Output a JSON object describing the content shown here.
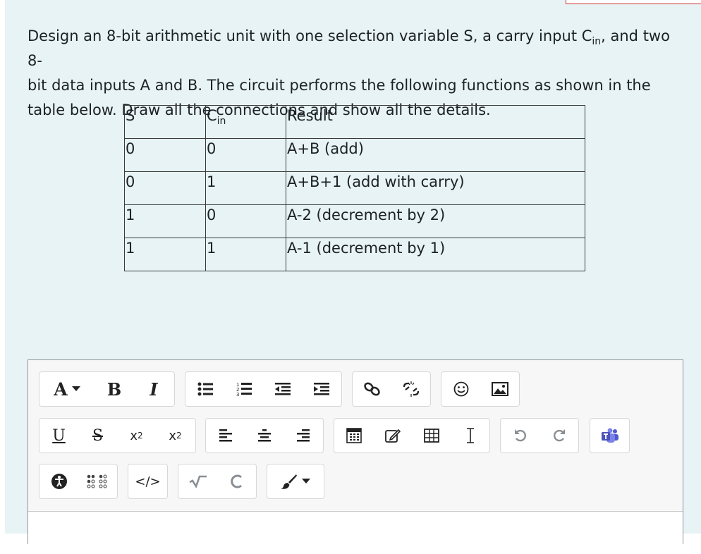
{
  "question": {
    "line1_before": "Design an 8-bit arithmetic unit with one selection variable S, a carry input C",
    "cin_sub": "in",
    "line1_after": ", and two 8-",
    "line2": "bit data inputs A and B. The circuit performs the following functions as shown in the",
    "line3": "table below. Draw all the connections and show all the details."
  },
  "table": {
    "header": {
      "s": "S",
      "c": "C",
      "c_sub": "in",
      "result": "Result"
    },
    "rows": [
      {
        "s": "0",
        "cin": "0",
        "result": "A+B (add)"
      },
      {
        "s": "0",
        "cin": "1",
        "result": "A+B+1 (add with carry)"
      },
      {
        "s": "1",
        "cin": "0",
        "result": "A-2 (decrement by 2)"
      },
      {
        "s": "1",
        "cin": "1",
        "result": "A-1 (decrement by 1)"
      }
    ]
  },
  "toolbar": {
    "font_color_label": "A",
    "bold_label": "B",
    "italic_label": "I",
    "underline_label": "U",
    "strike_label": "S",
    "subscript_label": "x",
    "subscript_sub": "2",
    "superscript_label": "x",
    "superscript_sup": "2",
    "html_label": "</>",
    "icons": [
      "bullet-list-icon",
      "numbered-list-icon",
      "outdent-icon",
      "indent-icon",
      "link-icon",
      "unlink-icon",
      "emoticon-icon",
      "image-icon",
      "align-left-icon",
      "align-center-icon",
      "align-right-icon",
      "equation-editor-icon",
      "draw-icon",
      "table-icon",
      "cursor-icon",
      "undo-icon",
      "redo-icon",
      "teams-meeting-icon",
      "accessibility-icon",
      "braille-icon",
      "math-sqrt-icon",
      "chemistry-icon",
      "paintbrush-icon"
    ]
  }
}
